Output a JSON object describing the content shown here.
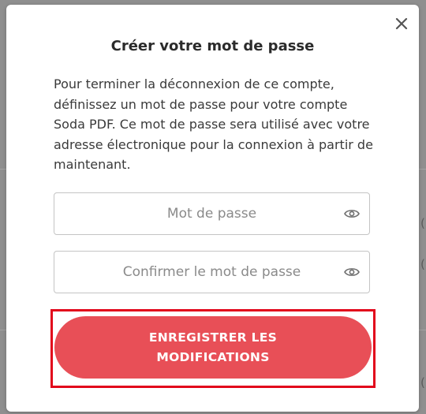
{
  "modal": {
    "title": "Créer votre mot de passe",
    "description": "Pour terminer la déconnexion de ce compte, définissez un mot de passe pour votre compte Soda PDF. Ce mot de passe sera utilisé avec votre adresse électronique pour la connexion à partir de maintenant.",
    "password": {
      "placeholder": "Mot de passe",
      "value": "",
      "icon": "eye-icon"
    },
    "confirm_password": {
      "placeholder": "Confirmer le mot de passe",
      "value": "",
      "icon": "eye-icon"
    },
    "save_button_label": "ENREGISTRER LES MODIFICATIONS",
    "close_icon": "close-icon",
    "highlight_color": "#e2061b",
    "button_color": "#e84f57"
  }
}
